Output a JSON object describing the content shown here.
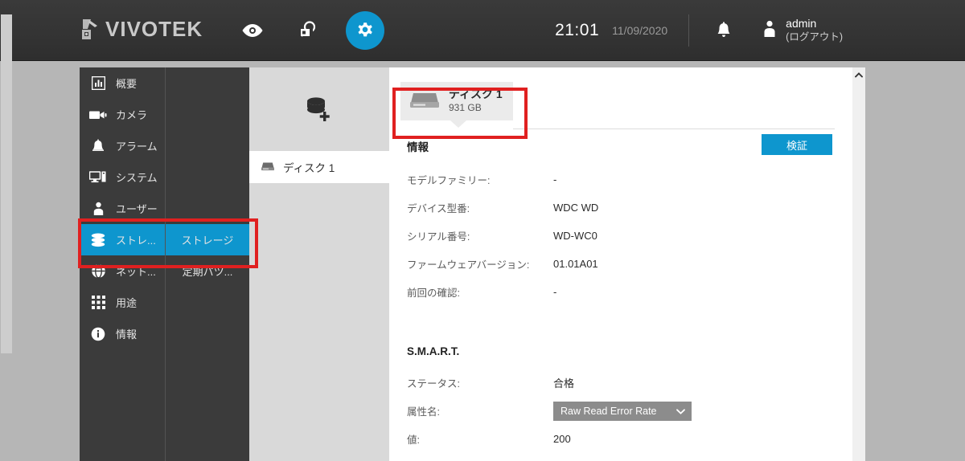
{
  "header": {
    "brand": "VIVOTEK",
    "icons": [
      {
        "name": "eye-icon",
        "label": "Live View"
      },
      {
        "name": "search-playback-icon",
        "label": "Playback"
      },
      {
        "name": "gear-icon",
        "label": "Settings"
      }
    ],
    "time": "21:01",
    "date": "11/09/2020",
    "bell_label": "Alerts",
    "user_name": "admin",
    "user_logout": "(ログアウト)"
  },
  "sidebar": {
    "items": [
      {
        "label": "概要",
        "icon": "bar-chart-icon",
        "selected": false
      },
      {
        "label": "カメラ",
        "icon": "video-camera-icon",
        "selected": false
      },
      {
        "label": "アラーム",
        "icon": "bell-icon",
        "selected": false
      },
      {
        "label": "システム",
        "icon": "desktop-tower-icon",
        "selected": false
      },
      {
        "label": "ユーザー",
        "icon": "person-icon",
        "selected": false
      },
      {
        "label": "ストレ...",
        "icon": "database-icon",
        "selected": true
      },
      {
        "label": "ネット...",
        "icon": "globe-network-icon",
        "selected": false
      },
      {
        "label": "用途",
        "icon": "grid-apps-icon",
        "selected": false
      },
      {
        "label": "情報",
        "icon": "info-circle-icon",
        "selected": false
      }
    ]
  },
  "subnav": {
    "items": [
      {
        "label": "ストレージ",
        "selected": true
      },
      {
        "label": "定期パツ...",
        "selected": false
      }
    ]
  },
  "midcol": {
    "add_storage_icon": "add-storage-icon",
    "disks": [
      {
        "label": "ディスク 1",
        "icon": "disk-icon"
      }
    ]
  },
  "main": {
    "disk_card": {
      "icon": "disk-icon",
      "title": "ディスク 1",
      "capacity": "931 GB"
    },
    "info": {
      "section_title": "情報",
      "verify_button": "検証",
      "rows": [
        {
          "key": "モデルファミリー:",
          "value": "-",
          "clipped": false
        },
        {
          "key": "デバイス型番:",
          "value": "WDC WD",
          "clipped": true
        },
        {
          "key": "シリアル番号:",
          "value": "WD-WC0",
          "clipped": true
        },
        {
          "key": "ファームウェアバージョン:",
          "value": "01.01A01",
          "clipped": false
        },
        {
          "key": "前回の確認:",
          "value": "-",
          "clipped": false
        }
      ]
    },
    "smart": {
      "section_title": "S.M.A.R.T.",
      "status_key": "ステータス:",
      "status_value": "合格",
      "attribute_key": "属性名:",
      "attribute_value": "Raw Read Error Rate",
      "value_key": "値:",
      "value_value": "200"
    }
  },
  "scrollbar": {
    "up_arrow_icon": "chevron-up-icon"
  },
  "colors": {
    "accent_blue": "#0e96ce",
    "header_dark": "#343434",
    "sidebar_dark": "#3b3b3b",
    "page_gray": "#b6b6b6",
    "annotation_red": "#e02020",
    "dropdown_gray": "#8c8c8c"
  }
}
